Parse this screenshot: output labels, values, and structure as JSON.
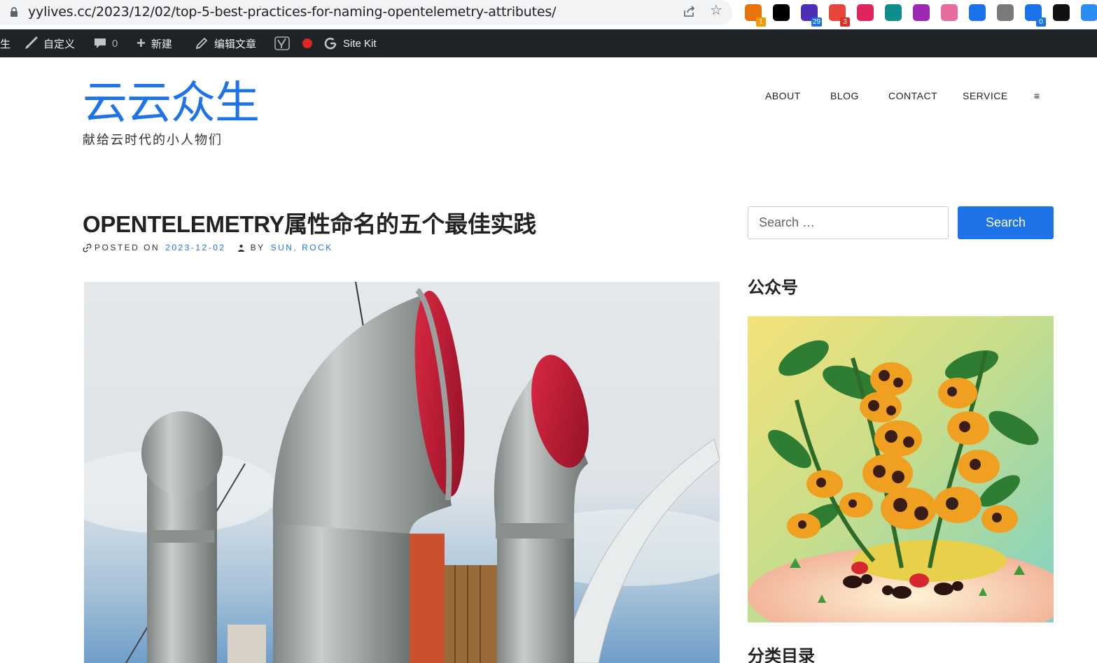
{
  "browser": {
    "url": "yylives.cc/2023/12/02/top-5-best-practices-for-naming-opentelemetry-attributes/",
    "extensions": [
      {
        "name": "extension-1",
        "badge": "1",
        "color": "#e8710a"
      },
      {
        "name": "notion",
        "badge": "",
        "color": "#000000"
      },
      {
        "name": "extension-3",
        "badge": "29",
        "color": "#4b2fb5"
      },
      {
        "name": "extension-4",
        "badge": "3",
        "color": "#e8453c"
      },
      {
        "name": "extension-5",
        "badge": "",
        "color": "#e0245e"
      },
      {
        "name": "extension-6",
        "badge": "",
        "color": "#0f8c8c"
      },
      {
        "name": "extension-7",
        "badge": "",
        "color": "#9c27b0"
      },
      {
        "name": "extension-8",
        "badge": "",
        "color": "#e66b9e"
      },
      {
        "name": "extension-9",
        "badge": "",
        "color": "#1a73e8"
      },
      {
        "name": "openai",
        "badge": "",
        "color": "#7a7a7a"
      },
      {
        "name": "extension-11",
        "badge": "0",
        "color": "#1a73e8"
      },
      {
        "name": "extension-12",
        "badge": "",
        "color": "#111111"
      },
      {
        "name": "extension-13",
        "badge": "",
        "color": "#2d8cf0"
      }
    ]
  },
  "adminbar": {
    "site_fragment": "生",
    "customize": "自定义",
    "comments_count": "0",
    "new": "新建",
    "edit_post": "编辑文章",
    "site_kit": "Site Kit"
  },
  "site": {
    "title": "云云众生",
    "description": "献给云时代的小人物们"
  },
  "nav": {
    "items": [
      "ABOUT",
      "BLOG",
      "CONTACT",
      "SERVICE"
    ],
    "menu_icon": "≡"
  },
  "post": {
    "title": "OPENTELEMETRY属性命名的五个最佳实践",
    "posted_on_label": "POSTED ON",
    "date": "2023-12-02",
    "by_label": "BY",
    "author": "SUN, ROCK"
  },
  "sidebar": {
    "search_placeholder": "Search …",
    "search_button": "Search",
    "widget_wechat_title": "公众号",
    "widget_categories_title": "分类目录"
  },
  "colors": {
    "accent": "#1e73e8",
    "adminbar_bg": "#1d2327"
  }
}
